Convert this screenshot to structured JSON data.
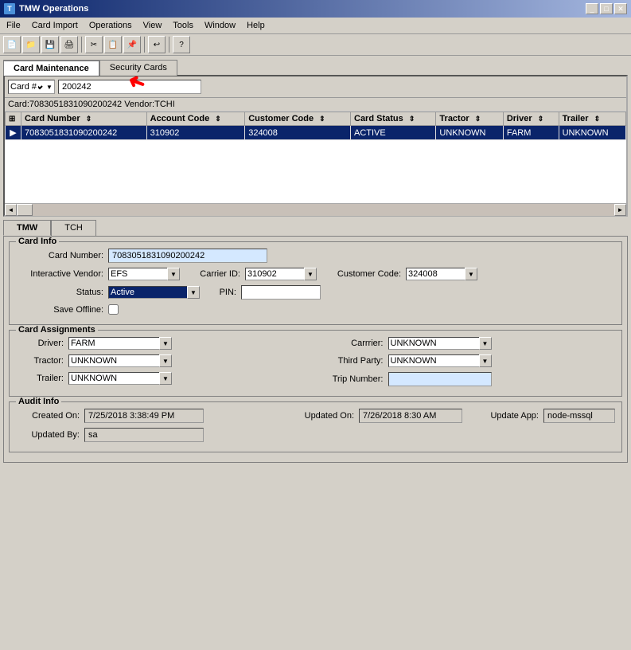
{
  "window": {
    "title": "TMW Operations",
    "icon": "tmw-icon"
  },
  "menu": {
    "items": [
      "File",
      "Card Import",
      "Operations",
      "View",
      "Tools",
      "Window",
      "Help"
    ]
  },
  "tabs": {
    "main": [
      "Card Maintenance",
      "Security Cards"
    ]
  },
  "search": {
    "label": "Card #",
    "value": "200242",
    "info_bar": "Card:7083051831090200242 Vendor:TCHI"
  },
  "grid": {
    "columns": [
      "",
      "Card Number",
      "Account Code",
      "Customer Code",
      "Card Status",
      "Tractor",
      "Driver",
      "Trailer"
    ],
    "rows": [
      {
        "num": "1",
        "card_number": "7083051831090200242",
        "account_code": "310902",
        "customer_code": "324008",
        "card_status": "ACTIVE",
        "tractor": "UNKNOWN",
        "driver": "FARM",
        "trailer": "UNKNOWN"
      }
    ]
  },
  "inner_tabs": [
    "TMW",
    "TCH"
  ],
  "card_info": {
    "group_title": "Card Info",
    "card_number_label": "Card Number:",
    "card_number_value": "7083051831090200242",
    "interactive_vendor_label": "Interactive Vendor:",
    "interactive_vendor_value": "EFS",
    "carrier_id_label": "Carrier ID:",
    "carrier_id_value": "310902",
    "customer_code_label": "Customer Code:",
    "customer_code_value": "324008",
    "status_label": "Status:",
    "status_value": "Active",
    "pin_label": "PIN:",
    "pin_value": "",
    "save_offline_label": "Save Offline:",
    "save_offline_checked": false
  },
  "card_assignments": {
    "group_title": "Card Assignments",
    "driver_label": "Driver:",
    "driver_value": "FARM",
    "carrier_label": "Carrrier:",
    "carrier_value": "UNKNOWN",
    "tractor_label": "Tractor:",
    "tractor_value": "UNKNOWN",
    "third_party_label": "Third Party:",
    "third_party_value": "UNKNOWN",
    "trailer_label": "Trailer:",
    "trailer_value": "UNKNOWN",
    "trip_number_label": "Trip Number:",
    "trip_number_value": ""
  },
  "audit_info": {
    "group_title": "Audit Info",
    "created_on_label": "Created On:",
    "created_on_value": "7/25/2018 3:38:49 PM",
    "updated_by_label": "Updated By:",
    "updated_by_value": "sa",
    "updated_on_label": "Updated On:",
    "updated_on_value": "7/26/2018 8:30 AM",
    "update_app_label": "Update App:",
    "update_app_value": "node-mssql"
  },
  "toolbar_icons": [
    "new",
    "open",
    "save",
    "print",
    "sep",
    "cut",
    "copy",
    "paste",
    "sep",
    "undo",
    "sep",
    "help"
  ]
}
